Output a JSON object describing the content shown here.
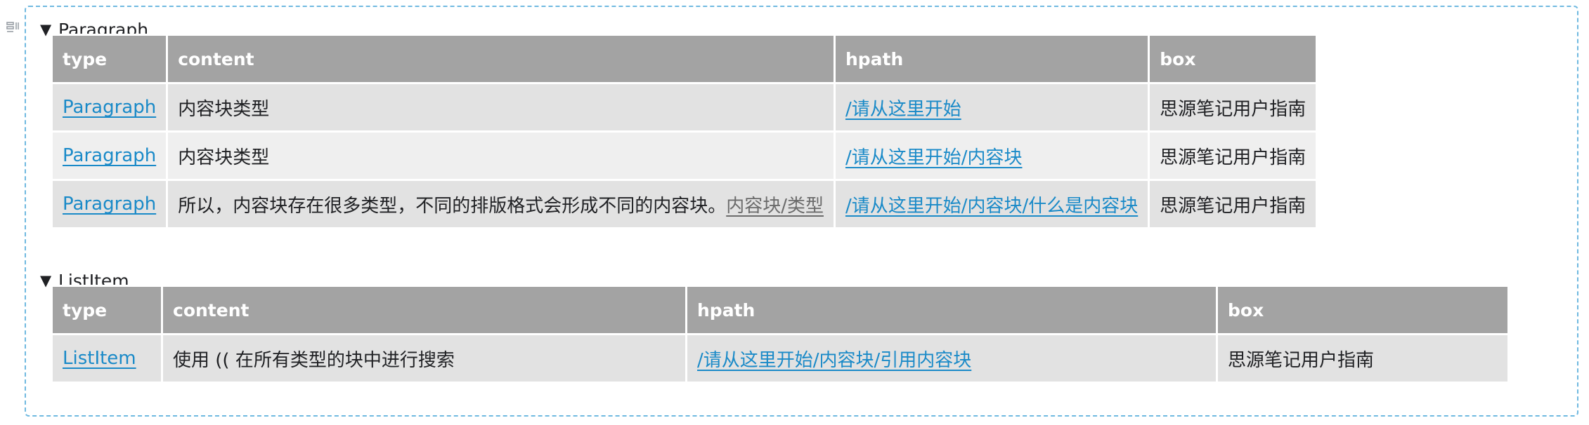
{
  "gutter_icon": "block-drag-icon",
  "groups": [
    {
      "title": "Paragraph",
      "columns": [
        "type",
        "content",
        "hpath",
        "box"
      ],
      "rows": [
        {
          "type": "Paragraph",
          "content": "内容块类型",
          "content_ref": "",
          "hpath": "/请从这里开始",
          "box": "思源笔记用户指南"
        },
        {
          "type": "Paragraph",
          "content": "内容块类型",
          "content_ref": "",
          "hpath": "/请从这里开始/内容块",
          "box": "思源笔记用户指南"
        },
        {
          "type": "Paragraph",
          "content": "所以，内容块存在很多类型，不同的排版格式会形成不同的内容块。",
          "content_ref": "内容块/类型",
          "hpath": "/请从这里开始/内容块/什么是内容块",
          "box": "思源笔记用户指南"
        }
      ]
    },
    {
      "title": "ListItem",
      "columns": [
        "type",
        "content",
        "hpath",
        "box"
      ],
      "rows": [
        {
          "type": "ListItem",
          "content": "使用 (( 在所有类型的块中进行搜索",
          "content_ref": "",
          "hpath": "/请从这里开始/内容块/引用内容块",
          "box": "思源笔记用户指南"
        }
      ]
    }
  ]
}
